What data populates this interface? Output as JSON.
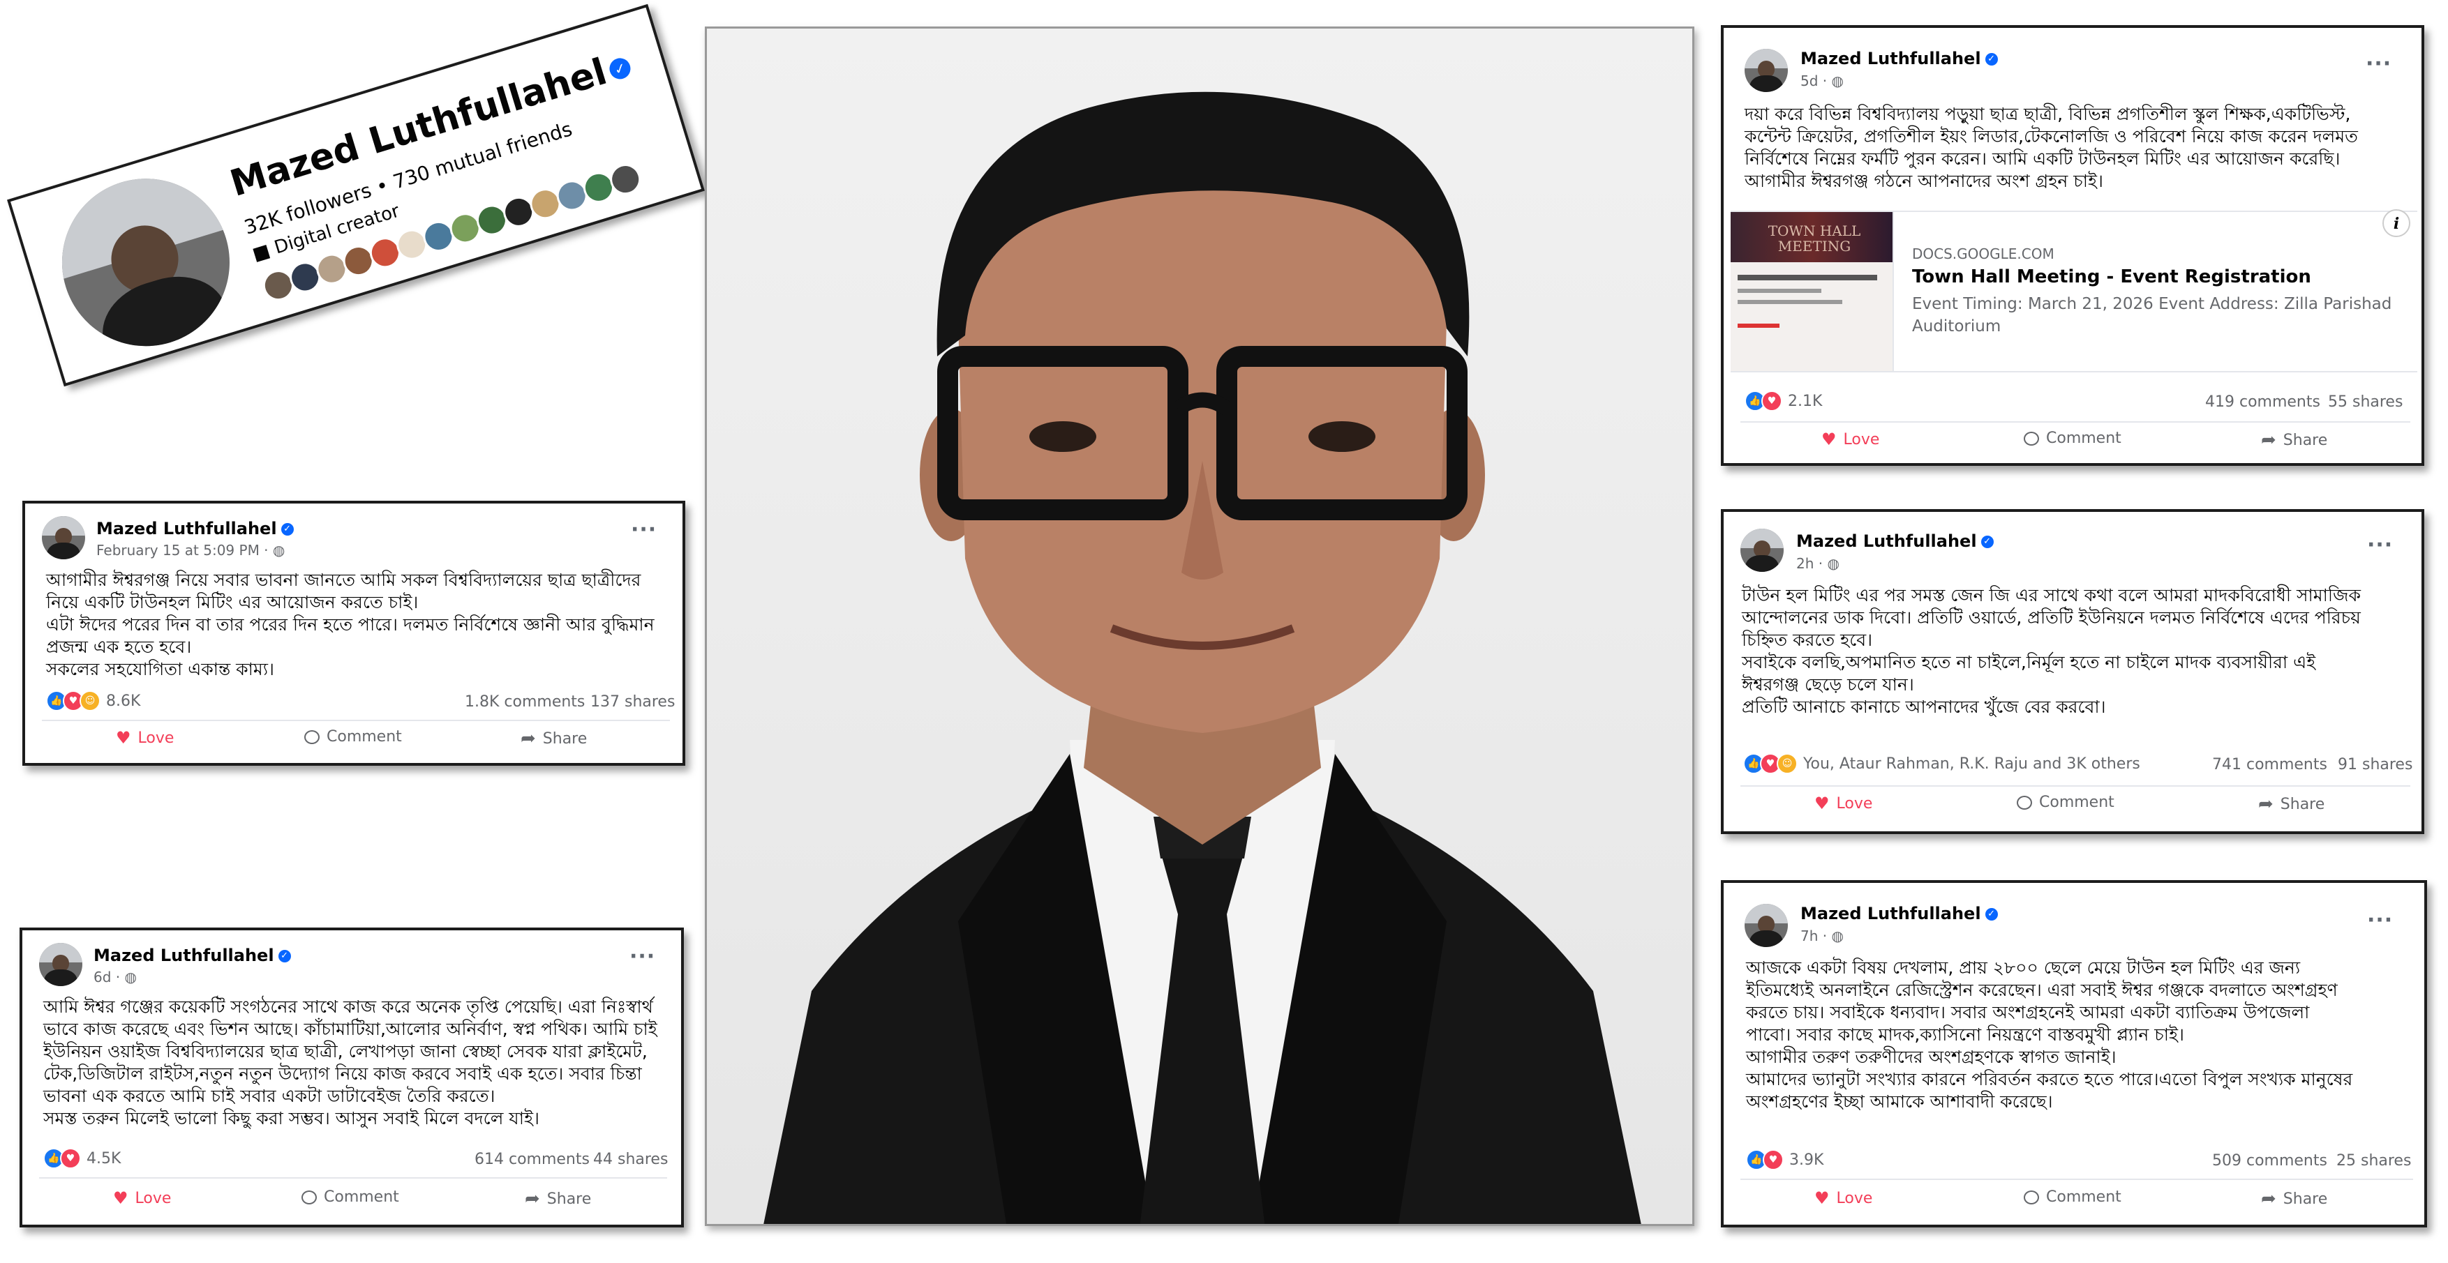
{
  "profile": {
    "name": "Mazed Luthfullahel",
    "stats": "32K followers • 730 mutual friends",
    "role": "Digital creator"
  },
  "posts": {
    "p1": {
      "author": "Mazed Luthfullahel",
      "time": "February 15 at 5:09 PM ·",
      "text": "আগামীর ঈশ্বরগঞ্জ নিয়ে সবার ভাবনা জানতে আমি সকল বিশ্ববিদ্যালয়ের ছাত্র ছাত্রীদের\nনিয়ে একটি টাউনহল মিটিং এর আয়োজন করতে চাই।\nএটা ঈদের পরের দিন বা তার পরের দিন হতে পারে। দলমত নির্বিশেষে জ্ঞানী আর বুদ্ধিমান\nপ্রজন্ম এক হতে হবে।\nসকলের সহযোগিতা একান্ত কাম্য।",
      "reactions": "8.6K",
      "comments": "1.8K comments",
      "shares": "137 shares",
      "love": "Love",
      "comment": "Comment",
      "share": "Share"
    },
    "p2": {
      "author": "Mazed Luthfullahel",
      "time": "6d ·",
      "text": "আমি ঈশ্বর গঞ্জের কয়েকটি সংগঠনের সাথে কাজ করে অনেক তৃপ্তি পেয়েছি। এরা নিঃস্বার্থ\nভাবে কাজ করেছে এবং ভিশন আছে। কাঁচামাটিয়া,আলোর অনির্বাণ, স্বপ্ন পথিক। আমি চাই\nইউনিয়ন ওয়াইজ বিশ্ববিদ্যালয়ের ছাত্র ছাত্রী, লেখাপড়া জানা স্বেচ্ছা সেবক যারা ক্লাইমেট,\nটেক,ডিজিটাল রাইটস,নতুন নতুন উদ্যোগ নিয়ে কাজ করবে সবাই এক হতে। সবার চিন্তা\nভাবনা এক করতে আমি চাই সবার একটা ডাটাবেইজ তৈরি করতে।\nসমস্ত তরুন মিলেই ভালো কিছু করা সম্ভব। আসুন সবাই মিলে বদলে যাই।",
      "reactions": "4.5K",
      "comments": "614 comments",
      "shares": "44 shares",
      "love": "Love",
      "comment": "Comment",
      "share": "Share"
    },
    "p3": {
      "author": "Mazed Luthfullahel",
      "time": "5d ·",
      "text": "দয়া করে বিভিন্ন বিশ্ববিদ্যালয় পড়ুয়া ছাত্র ছাত্রী, বিভিন্ন প্রগতিশীল স্কুল শিক্ষক,একটিভিস্ট,\nকন্টেন্ট ক্রিয়েটর, প্রগতিশীল ইয়ং লিডার,টেকনোলজি ও পরিবেশ নিয়ে কাজ করেন দলমত\nনির্বিশেষে নিম্নের ফর্মটি পুরন করেন। আমি একটি টাউনহল মিটিং এর আয়োজন করেছি।\nআগামীর ঈশ্বরগঞ্জ গঠনে আপনাদের অংশ গ্রহন চাই।",
      "link_thumb_title": "TOWN HALL MEETING",
      "link_domain": "DOCS.GOOGLE.COM",
      "link_title": "Town Hall Meeting - Event Registration",
      "link_desc": "Event Timing: March 21, 2026 Event Address: Zilla Parishad\nAuditorium",
      "reactions": "2.1K",
      "comments": "419 comments",
      "shares": "55 shares",
      "love": "Love",
      "comment": "Comment",
      "share": "Share"
    },
    "p4": {
      "author": "Mazed Luthfullahel",
      "time": "2h ·",
      "text": "টাউন হল মিটিং এর পর সমস্ত জেন জি এর সাথে কথা বলে আমরা মাদকবিরোধী সামাজিক\nআন্দোলনের ডাক দিবো। প্রতিটি ওয়ার্ডে, প্রতিটি ইউনিয়নে দলমত নির্বিশেষে এদের পরিচয়\nচিহ্নিত করতে হবে।\nসবাইকে বলছি,অপমানিত হতে না চাইলে,নির্মূল হতে না চাইলে মাদক ব্যবসায়ীরা এই\nঈশ্বরগঞ্জ ছেড়ে চলে যান।\nপ্রতিটি আনাচে কানাচে আপনাদের খুঁজে বের করবো।",
      "reactions": "You, Ataur Rahman, R.K. Raju and 3K others",
      "comments": "741 comments",
      "shares": "91 shares",
      "love": "Love",
      "comment": "Comment",
      "share": "Share"
    },
    "p5": {
      "author": "Mazed Luthfullahel",
      "time": "7h ·",
      "text": "আজকে একটা বিষয় দেখলাম, প্রায় ২৮০০ ছেলে মেয়ে টাউন হল মিটিং এর জন্য\nইতিমধ্যেই অনলাইনে রেজিস্ট্রেশন করেছেন। এরা সবাই ঈশ্বর গঞ্জকে বদলাতে অংশগ্রহণ\nকরতে চায়। সবাইকে ধন্যবাদ। সবার অংশগ্রহনেই আমরা একটা ব্যাতিক্রম উপজেলা\nপাবো। সবার কাছে মাদক,ক্যাসিনো নিয়ন্ত্রণে বাস্তবমুখী প্ল্যান চাই।\nআগামীর তরুণ তরুণীদের অংশগ্রহণকে স্বাগত জানাই।\nআমাদের ভ্যানুটা সংখ্যার কারনে পরিবর্তন করতে হতে পারে।এতো বিপুল সংখ্যক মানুষের\nঅংশগ্রহণের ইচ্ছা আমাকে আশাবাদী করেছে।",
      "reactions": "3.9K",
      "comments": "509 comments",
      "shares": "25 shares",
      "love": "Love",
      "comment": "Comment",
      "share": "Share"
    }
  },
  "icons": {
    "verified": "verified-badge-icon",
    "globe": "globe-icon",
    "more": "more-options-icon",
    "like": "like-reaction-icon",
    "love": "heart-icon",
    "comment": "comment-icon",
    "share": "share-icon"
  },
  "colors": {
    "facebook_blue": "#0866ff",
    "love_red": "#f33e58",
    "secondary_text": "#65676b"
  }
}
